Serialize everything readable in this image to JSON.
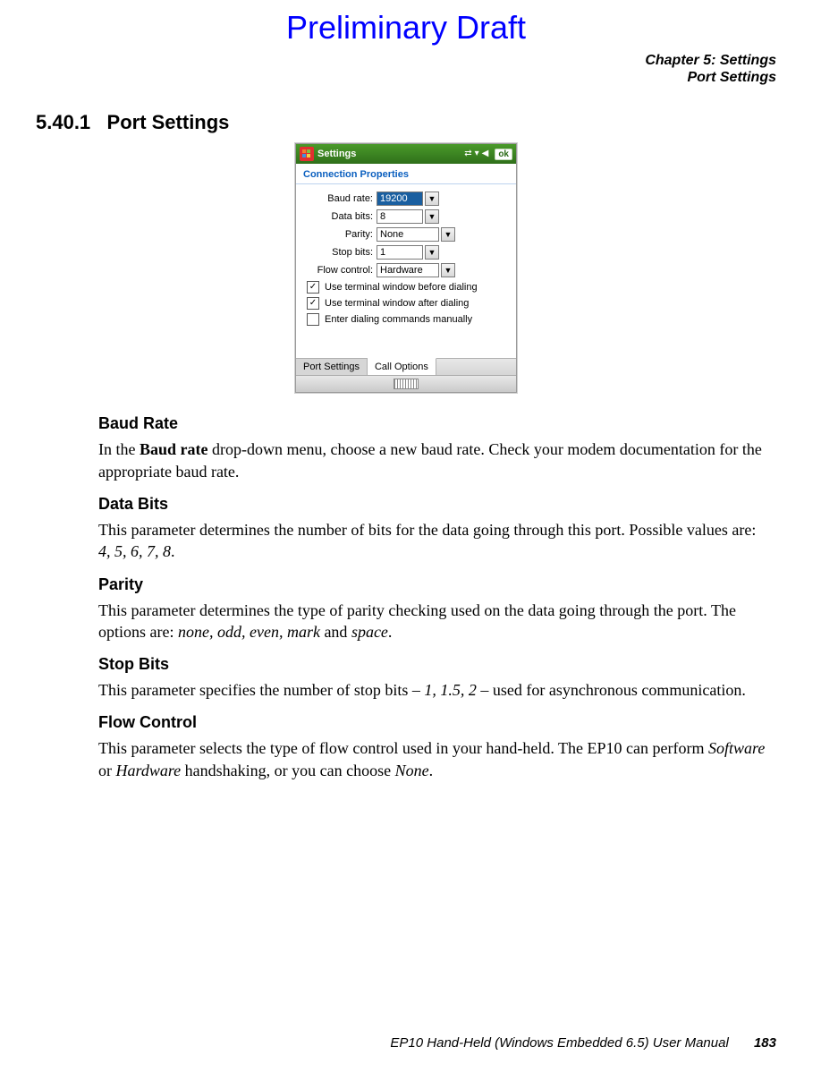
{
  "draft_label": "Preliminary Draft",
  "chapter_header": {
    "line1": "Chapter 5: Settings",
    "line2": "Port Settings"
  },
  "section": {
    "number": "5.40.1",
    "title": "Port Settings"
  },
  "screenshot": {
    "window_title": "Settings",
    "ok_label": "ok",
    "panel_title": "Connection Properties",
    "fields": {
      "baud_rate": {
        "label": "Baud rate:",
        "value": "19200"
      },
      "data_bits": {
        "label": "Data bits:",
        "value": "8"
      },
      "parity": {
        "label": "Parity:",
        "value": "None"
      },
      "stop_bits": {
        "label": "Stop bits:",
        "value": "1"
      },
      "flow_ctrl": {
        "label": "Flow control:",
        "value": "Hardware"
      }
    },
    "checks": [
      {
        "label": "Use terminal window before dialing",
        "checked": true
      },
      {
        "label": "Use terminal window after dialing",
        "checked": true
      },
      {
        "label": "Enter dialing commands manually",
        "checked": false
      }
    ],
    "tabs": [
      {
        "label": "Port Settings",
        "active": false
      },
      {
        "label": "Call Options",
        "active": true
      }
    ]
  },
  "sections": {
    "baud_rate": {
      "heading": "Baud Rate",
      "p_pre": "In the ",
      "p_bold": "Baud rate",
      "p_post": " drop-down menu, choose a new baud rate. Check your modem documentation for the appropriate baud rate."
    },
    "data_bits": {
      "heading": "Data Bits",
      "p_pre": "This parameter determines the number of bits for the data going through this port. Possible values are: ",
      "p_ital": "4, 5, 6, 7, 8",
      "p_post": "."
    },
    "parity": {
      "heading": "Parity",
      "p_pre": "This parameter determines the type of parity checking used on the data going through the port. The options are: ",
      "p_ital": "none, odd, even, mark",
      "p_mid": " and ",
      "p_ital2": "space",
      "p_post": "."
    },
    "stop_bits": {
      "heading": "Stop Bits",
      "p_pre": "This parameter specifies the number of stop bits – ",
      "p_ital": "1, 1.5, 2",
      "p_post": " – used for asynchronous communication."
    },
    "flow_control": {
      "heading": "Flow Control",
      "p_pre": "This parameter selects the type of flow control used in your hand-held. The EP10 can perform ",
      "p_ital": "Software",
      "p_mid": " or ",
      "p_ital2": "Hardware",
      "p_mid2": " handshaking, or you can choose ",
      "p_ital3": "None",
      "p_post": "."
    }
  },
  "footer": {
    "manual": "EP10 Hand-Held (Windows Embedded 6.5) User Manual",
    "page": "183"
  }
}
